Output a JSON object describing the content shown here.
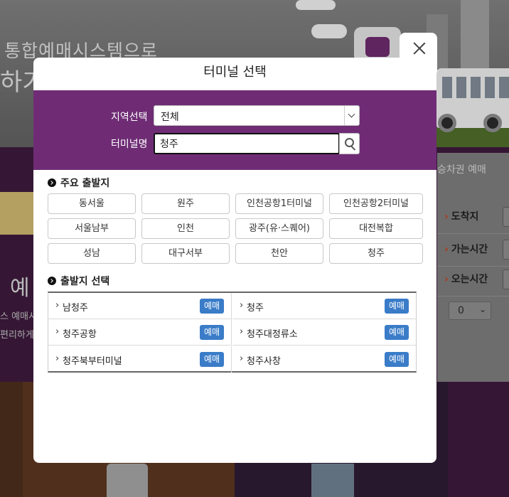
{
  "background": {
    "hero_line1": "통합예매시스템으로",
    "hero_line2": "하기",
    "big_char": "예",
    "small_line1": "스 예매시",
    "small_line2": "편리하게",
    "tab_label": "승차권 예매",
    "rows": [
      {
        "label": "도착지"
      },
      {
        "label": "가는시간"
      },
      {
        "label": "오는시간"
      }
    ],
    "count_select": "0"
  },
  "modal": {
    "title": "터미널 선택",
    "region_label": "지역선택",
    "region_value": "전체",
    "name_label": "터미널명",
    "name_value": "청주",
    "major_title": "주요 출발지",
    "major_terminals": [
      "동서울",
      "원주",
      "인천공항1터미널",
      "인천공항2터미널",
      "서울남부",
      "인천",
      "광주(유·스퀘어)",
      "대전복합",
      "성남",
      "대구서부",
      "천안",
      "청주"
    ],
    "results_title": "출발지 선택",
    "reserve_label": "예매",
    "results": [
      {
        "name": "남청주"
      },
      {
        "name": "청주"
      },
      {
        "name": "청주공항"
      },
      {
        "name": "청주대정류소"
      },
      {
        "name": "청주북부터미널"
      },
      {
        "name": "청주사창"
      }
    ]
  },
  "colors": {
    "band": "#6f2c75",
    "reserve_button": "#3a7cc8"
  }
}
